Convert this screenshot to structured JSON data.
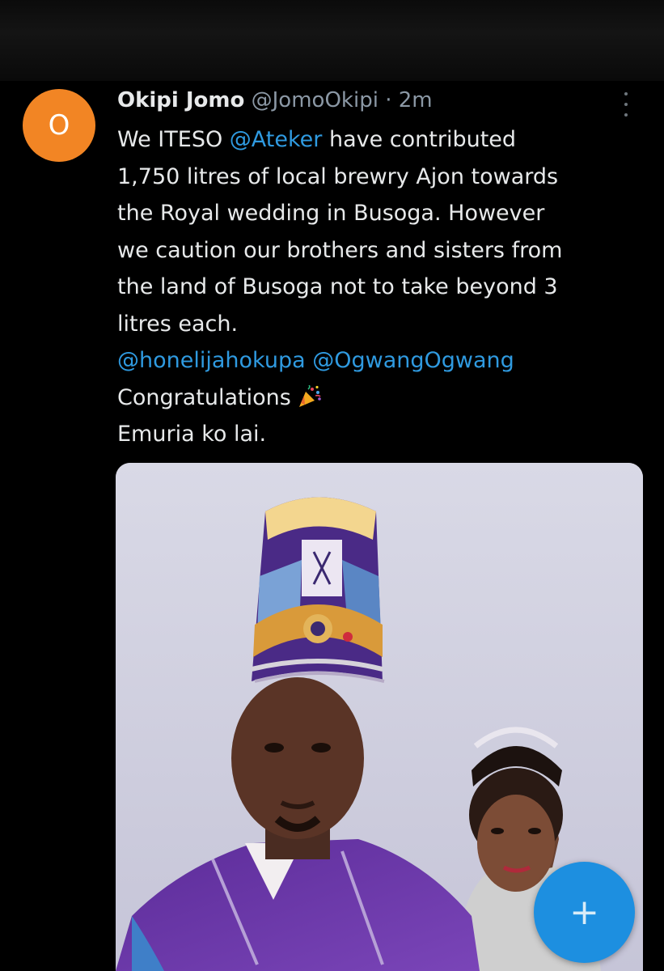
{
  "tweet": {
    "avatar_letter": "O",
    "display_name": "Okipi Jomo",
    "handle": "@JomoOkipi",
    "separator": "·",
    "time": "2m",
    "more_icon": "more-vertical-icon",
    "lines": {
      "l1_pre": "We ITESO ",
      "l1_mention": "@Ateker",
      "l1_post": " have contributed",
      "l2": "1,750 litres of local brewry Ajon towards",
      "l3": "the Royal wedding in Busoga. However",
      "l4": "we caution our brothers and sisters from",
      "l5": "the land of Busoga not to take beyond 3",
      "l6": "litres each.",
      "mention_1": "@honelijahokupa",
      "mention_2": "@OgwangOgwang",
      "congrats": "Congratulations ",
      "closing": "Emuria ko lai."
    },
    "emoji_icon": "party-popper-icon"
  },
  "fab": {
    "label": "+",
    "icon": "plus-icon"
  },
  "colors": {
    "avatar": "#f28524",
    "link": "#2f9ae0",
    "fab": "#1d8fe0",
    "text": "#e7e9ea",
    "muted": "#8b98a5"
  }
}
